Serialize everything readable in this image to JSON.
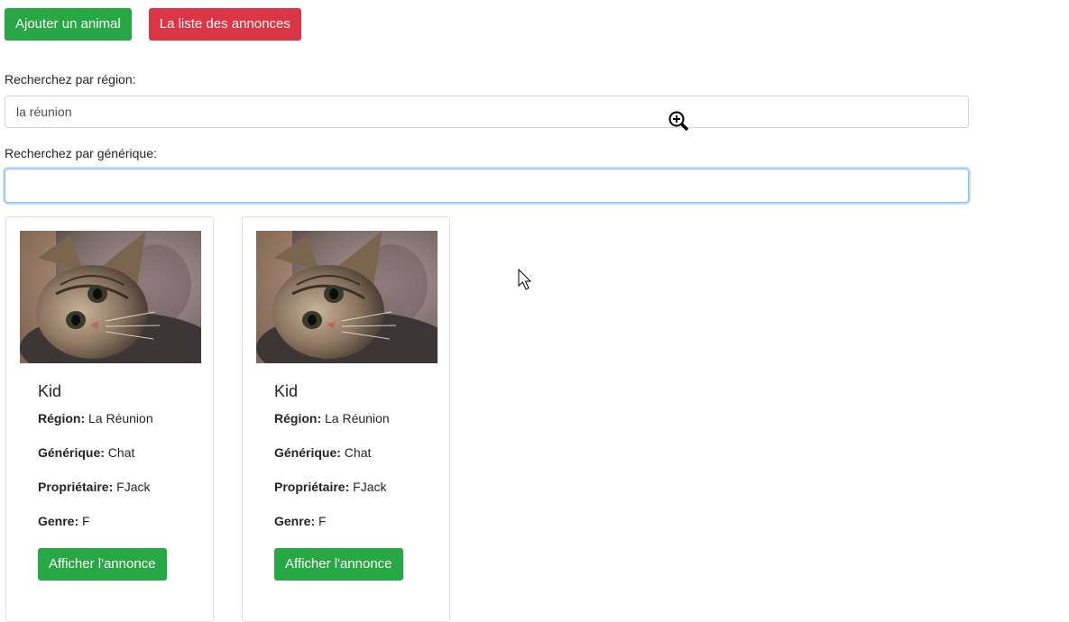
{
  "toolbar": {
    "add_animal": "Ajouter un animal",
    "list_ads": "La liste des annonces"
  },
  "search": {
    "region_label": "Recherchez par région:",
    "region_value": "la réunion",
    "generic_label": "Recherchez par générique:",
    "generic_value": ""
  },
  "cards": [
    {
      "name": "Kid",
      "region_label": "Région:",
      "region": "La Réunion",
      "generic_label": "Générique:",
      "generic": "Chat",
      "owner_label": "Propriétaire:",
      "owner": "FJack",
      "gender_label": "Genre:",
      "gender": "F",
      "button": "Afficher l'annonce"
    },
    {
      "name": "Kid",
      "region_label": "Région:",
      "region": "La Réunion",
      "generic_label": "Générique:",
      "generic": "Chat",
      "owner_label": "Propriétaire:",
      "owner": "FJack",
      "gender_label": "Genre:",
      "gender": "F",
      "button": "Afficher l'annonce"
    }
  ],
  "colors": {
    "success": "#28a745",
    "danger": "#dc3545",
    "focus_border": "#80bdff"
  },
  "icons": {
    "zoom": "zoom-in-cursor-icon",
    "pointer": "mouse-pointer-icon",
    "photo": "cat-photo"
  }
}
